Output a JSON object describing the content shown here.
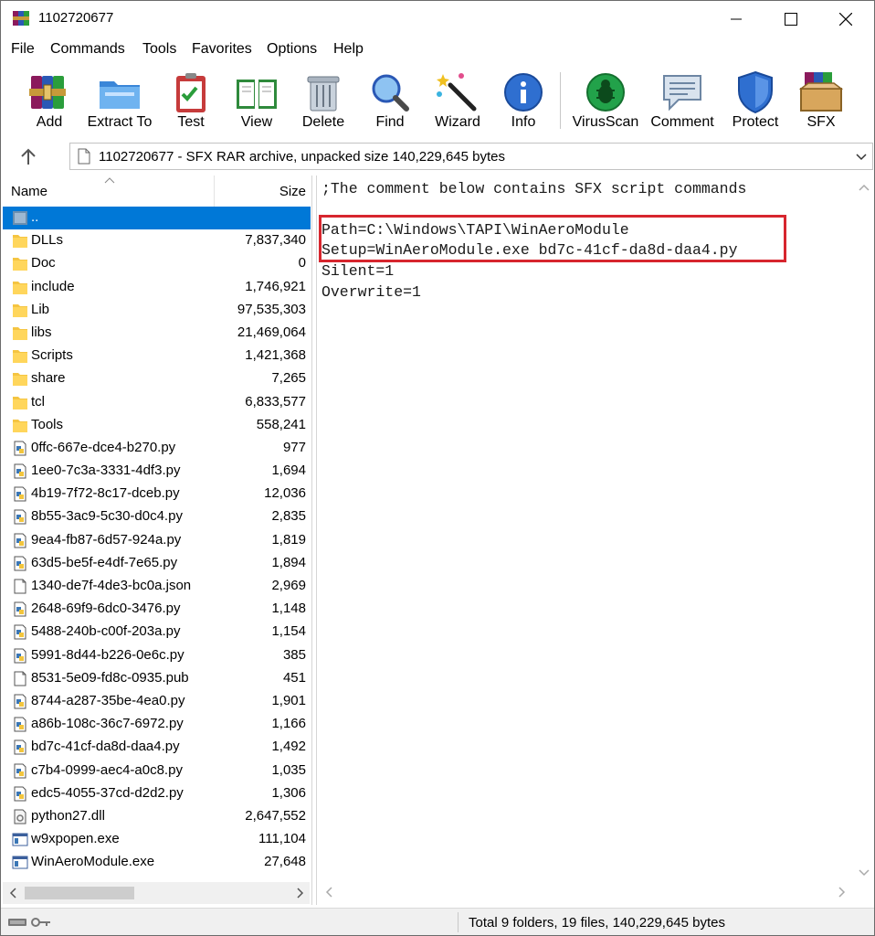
{
  "window": {
    "title": "1102720677"
  },
  "menu": [
    "File",
    "Commands",
    "Tools",
    "Favorites",
    "Options",
    "Help"
  ],
  "toolbar": {
    "add": "Add",
    "extract": "Extract To",
    "test": "Test",
    "view": "View",
    "delete": "Delete",
    "find": "Find",
    "wizard": "Wizard",
    "info": "Info",
    "virusscan": "VirusScan",
    "comment": "Comment",
    "protect": "Protect",
    "sfx": "SFX"
  },
  "address": {
    "text": "1102720677 - SFX RAR archive, unpacked size 140,229,645 bytes"
  },
  "filelist": {
    "col_name": "Name",
    "col_size": "Size",
    "rows": [
      {
        "name": "..",
        "size": "",
        "type": "parent"
      },
      {
        "name": "DLLs",
        "size": "7,837,340",
        "type": "folder"
      },
      {
        "name": "Doc",
        "size": "0",
        "type": "folder"
      },
      {
        "name": "include",
        "size": "1,746,921",
        "type": "folder"
      },
      {
        "name": "Lib",
        "size": "97,535,303",
        "type": "folder"
      },
      {
        "name": "libs",
        "size": "21,469,064",
        "type": "folder"
      },
      {
        "name": "Scripts",
        "size": "1,421,368",
        "type": "folder"
      },
      {
        "name": "share",
        "size": "7,265",
        "type": "folder"
      },
      {
        "name": "tcl",
        "size": "6,833,577",
        "type": "folder"
      },
      {
        "name": "Tools",
        "size": "558,241",
        "type": "folder"
      },
      {
        "name": "0ffc-667e-dce4-b270.py",
        "size": "977",
        "type": "py"
      },
      {
        "name": "1ee0-7c3a-3331-4df3.py",
        "size": "1,694",
        "type": "py"
      },
      {
        "name": "4b19-7f72-8c17-dceb.py",
        "size": "12,036",
        "type": "py"
      },
      {
        "name": "8b55-3ac9-5c30-d0c4.py",
        "size": "2,835",
        "type": "py"
      },
      {
        "name": "9ea4-fb87-6d57-924a.py",
        "size": "1,819",
        "type": "py"
      },
      {
        "name": "63d5-be5f-e4df-7e65.py",
        "size": "1,894",
        "type": "py"
      },
      {
        "name": "1340-de7f-4de3-bc0a.json",
        "size": "2,969",
        "type": "doc"
      },
      {
        "name": "2648-69f9-6dc0-3476.py",
        "size": "1,148",
        "type": "py"
      },
      {
        "name": "5488-240b-c00f-203a.py",
        "size": "1,154",
        "type": "py"
      },
      {
        "name": "5991-8d44-b226-0e6c.py",
        "size": "385",
        "type": "py"
      },
      {
        "name": "8531-5e09-fd8c-0935.pub",
        "size": "451",
        "type": "doc"
      },
      {
        "name": "8744-a287-35be-4ea0.py",
        "size": "1,901",
        "type": "py"
      },
      {
        "name": "a86b-108c-36c7-6972.py",
        "size": "1,166",
        "type": "py"
      },
      {
        "name": "bd7c-41cf-da8d-daa4.py",
        "size": "1,492",
        "type": "py"
      },
      {
        "name": "c7b4-0999-aec4-a0c8.py",
        "size": "1,035",
        "type": "py"
      },
      {
        "name": "edc5-4055-37cd-d2d2.py",
        "size": "1,306",
        "type": "py"
      },
      {
        "name": "python27.dll",
        "size": "2,647,552",
        "type": "dll"
      },
      {
        "name": "w9xpopen.exe",
        "size": "111,104",
        "type": "exe"
      },
      {
        "name": "WinAeroModule.exe",
        "size": "27,648",
        "type": "exe"
      }
    ]
  },
  "comment": {
    "lines": [
      ";The comment below contains SFX script commands",
      "",
      "Path=C:\\Windows\\TAPI\\WinAeroModule",
      "Setup=WinAeroModule.exe bd7c-41cf-da8d-daa4.py",
      "Silent=1",
      "Overwrite=1"
    ],
    "highlight_color": "#d7262e"
  },
  "status": {
    "text": "Total 9 folders, 19 files, 140,229,645 bytes"
  }
}
